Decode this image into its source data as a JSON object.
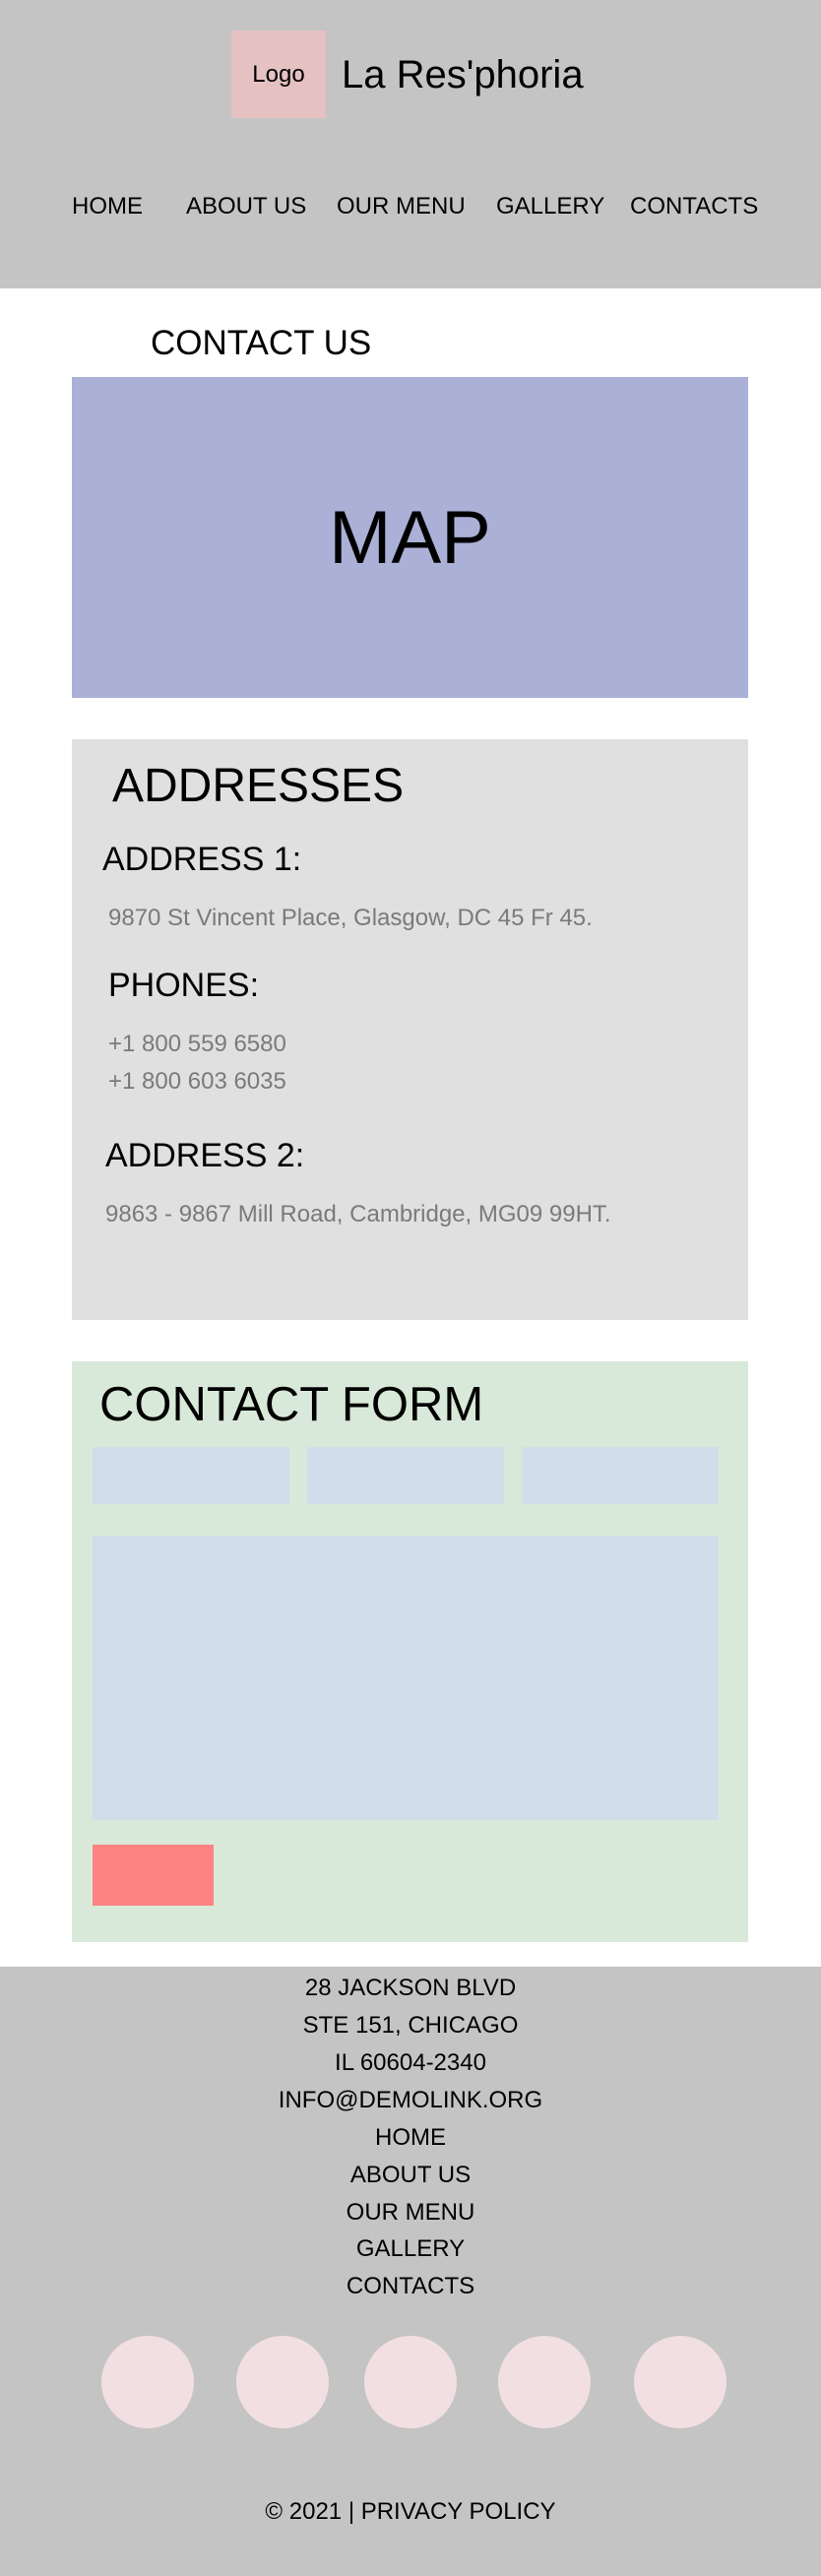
{
  "header": {
    "logo_label": "Logo",
    "site_title": "La Res'phoria",
    "nav": [
      "HOME",
      "ABOUT US",
      "OUR MENU",
      "GALLERY",
      "CONTACTS"
    ]
  },
  "contact": {
    "heading": "CONTACT US",
    "map_label": "MAP"
  },
  "addresses": {
    "title": "ADDRESSES",
    "address1_label": "ADDRESS 1:",
    "address1_text": "9870 St Vincent Place, Glasgow, DC 45 Fr 45.",
    "phones_label": "PHONES:",
    "phones": [
      "+1 800 559 6580",
      "+1 800 603 6035"
    ],
    "address2_label": "ADDRESS 2:",
    "address2_text": "9863 - 9867 Mill Road, Cambridge, MG09 99HT."
  },
  "contact_form": {
    "title": "CONTACT FORM"
  },
  "footer": {
    "address_lines": [
      "28 JACKSON BLVD",
      "STE 151, CHICAGO",
      "IL 60604-2340"
    ],
    "email": "INFO@DEMOLINK.ORG",
    "links": [
      "HOME",
      "ABOUT US",
      "OUR MENU",
      "GALLERY",
      "CONTACTS"
    ],
    "copyright": "© 2021 | PRIVACY POLICY"
  },
  "colors": {
    "header_bg": "#c4c4c4",
    "logo_bg": "#e5c1c1",
    "map_bg": "#abb1d6",
    "addresses_bg": "#e1e0e1",
    "form_bg": "#d9e9d9",
    "field_bg": "#d1ddeb",
    "submit_bg": "#ff8282",
    "social_circle": "#f2dfe2"
  }
}
